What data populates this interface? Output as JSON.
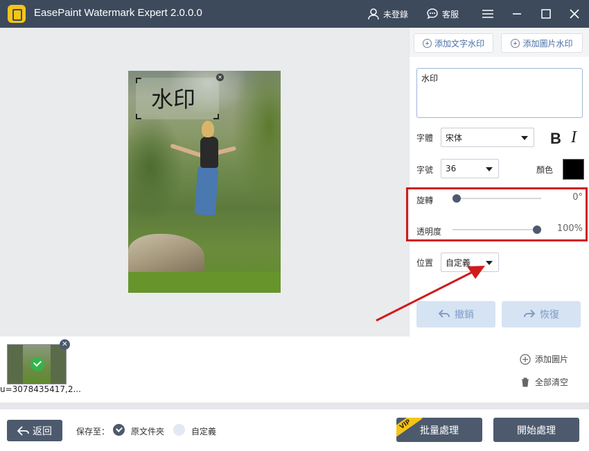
{
  "app": {
    "title": "EasePaint Watermark Expert  2.0.0.0"
  },
  "titlebar": {
    "user_label": "未登錄",
    "support_label": "客服"
  },
  "canvas": {
    "watermark_text": "水印"
  },
  "panel": {
    "add_text_watermark": "添加文字水印",
    "add_image_watermark": "添加圖片水印",
    "text_value": "水印",
    "font_label": "字體",
    "font_value": "宋体",
    "bold_label": "B",
    "italic_label": "I",
    "size_label": "字號",
    "size_value": "36",
    "color_label": "顏色",
    "color_value": "#000000",
    "rotation_label": "旋轉",
    "rotation_value": "0°",
    "rotation_fraction": 0.0,
    "opacity_label": "透明度",
    "opacity_value": "100%",
    "opacity_fraction": 1.0,
    "position_label": "位置",
    "position_value": "自定義",
    "undo_label": "撤銷",
    "redo_label": "恢復"
  },
  "strip": {
    "thumb_name": "u=3078435417,2...",
    "add_image": "添加圖片",
    "clear_all": "全部清空"
  },
  "bottom": {
    "back_label": "返回",
    "save_to_label": "保存至：",
    "option_original": "原文件夾",
    "option_custom": "自定義",
    "vip_badge": "VIP",
    "batch_label": "批量處理",
    "start_label": "開始處理"
  },
  "colors": {
    "titlebar": "#3d4a5c",
    "accent": "#4d5a6e",
    "highlight": "#d01b1b",
    "logo": "#f5c518"
  }
}
